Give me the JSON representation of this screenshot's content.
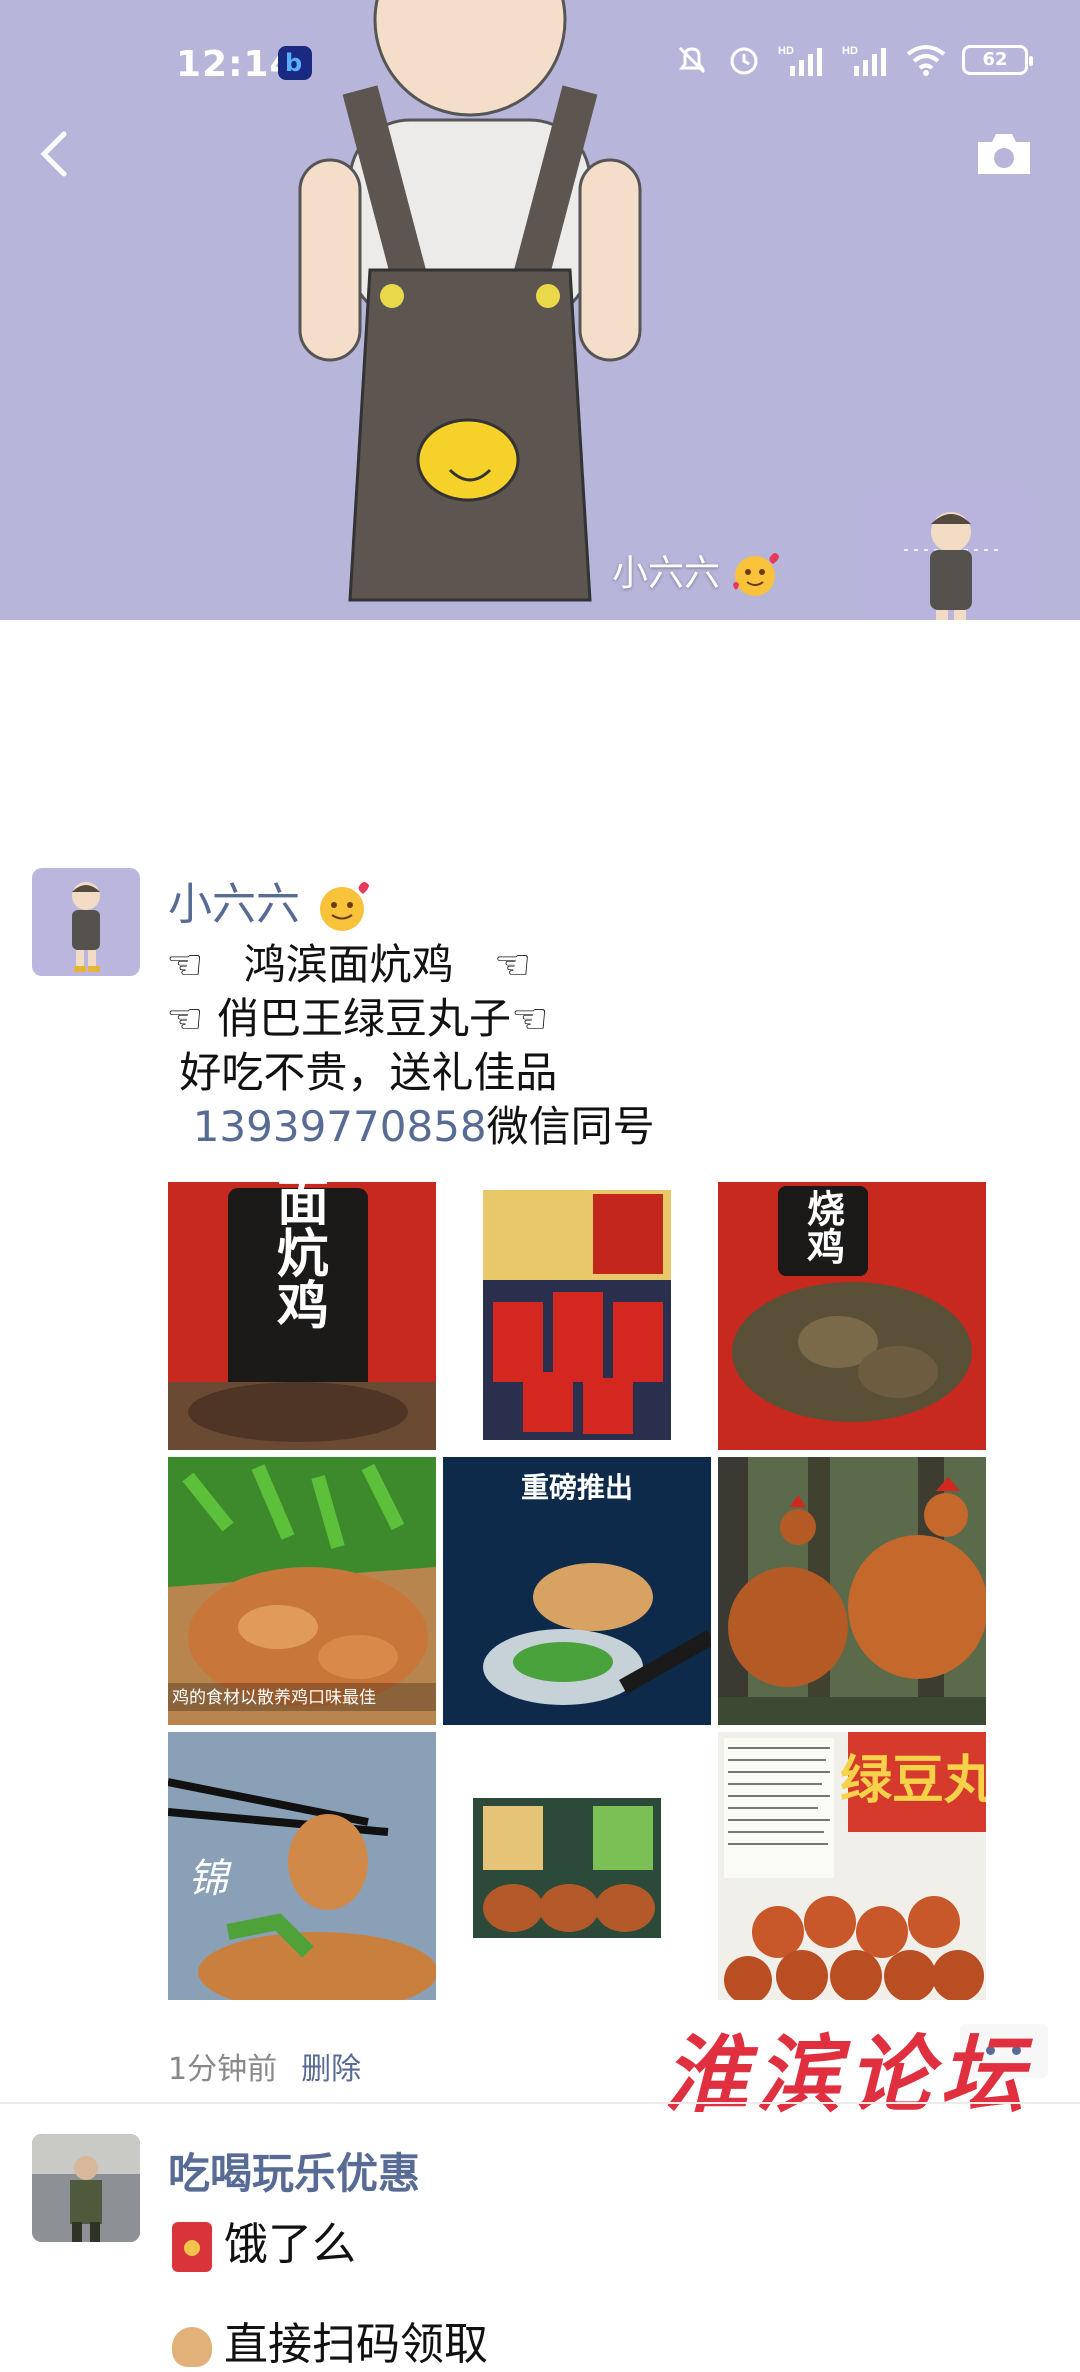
{
  "status_bar": {
    "time": "12:14",
    "battery": "62",
    "net_label_1": "HD",
    "net_label_2": "HD"
  },
  "cover": {
    "owner_name": "小六六"
  },
  "post": {
    "author": "小六六",
    "lines": [
      "☜   鸿滨面炕鸡   ☜",
      "☜ 俏巴王绿豆丸子☜",
      " 好吃不贵，送礼佳品"
    ],
    "phone": "13939770858",
    "phone_suffix": "微信同号",
    "image_texts": {
      "img1": "面炕鸡",
      "img3": "烧鸡",
      "img5": "重磅推出",
      "img4_caption": "鸡的食材以散养鸡口味最佳",
      "img7": "锦",
      "img9": "绿豆丸"
    },
    "time": "1分钟前",
    "delete_label": "删除"
  },
  "watermark": "淮滨论坛",
  "post2": {
    "author": "吃喝玩乐优惠",
    "line1": "饿了么",
    "line2": "直接扫码领取"
  },
  "colors": {
    "link": "#576b95",
    "cover_bg": "#b8b5db",
    "watermark": "#e03040"
  }
}
